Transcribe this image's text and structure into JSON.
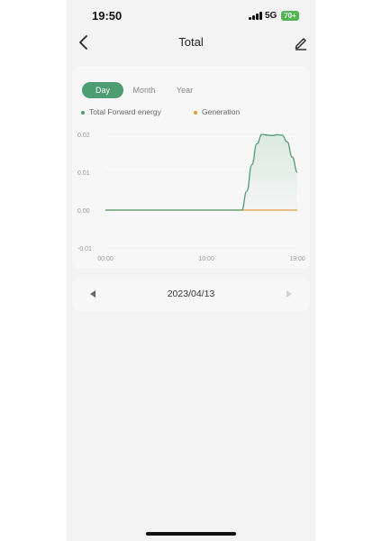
{
  "status_bar": {
    "time": "19:50",
    "network": "5G",
    "battery": "70+"
  },
  "header": {
    "title": "Total"
  },
  "tabs": [
    {
      "label": "Day",
      "active": true
    },
    {
      "label": "Month",
      "active": false
    },
    {
      "label": "Year",
      "active": false
    }
  ],
  "legend": [
    {
      "label": "Total Forward energy",
      "color": "#4e9d72"
    },
    {
      "label": "Generation",
      "color": "#e39a3a"
    }
  ],
  "chart_data": {
    "type": "area",
    "x_ticks": [
      "00:00",
      "10:00",
      "19:00"
    ],
    "y_ticks": [
      "0.02",
      "0.01",
      "0.00",
      "-0.01"
    ],
    "ylim": [
      -0.01,
      0.02
    ],
    "grid": true,
    "legend_position": "top-left",
    "series": [
      {
        "name": "Total Forward energy",
        "color": "#4e9d72",
        "points": [
          [
            0,
            0
          ],
          [
            13.5,
            0
          ],
          [
            14,
            0.005
          ],
          [
            14.5,
            0.012
          ],
          [
            15,
            0.0175
          ],
          [
            15.5,
            0.02
          ],
          [
            16,
            0.0198
          ],
          [
            16.5,
            0.0197
          ],
          [
            17,
            0.0199
          ],
          [
            17.5,
            0.0198
          ],
          [
            18,
            0.018
          ],
          [
            18.5,
            0.014
          ],
          [
            19,
            0.01
          ]
        ]
      },
      {
        "name": "Generation",
        "color": "#e39a3a",
        "points": [
          [
            0,
            0
          ],
          [
            19,
            0
          ]
        ]
      }
    ]
  },
  "date_nav": {
    "date": "2023/04/13"
  }
}
